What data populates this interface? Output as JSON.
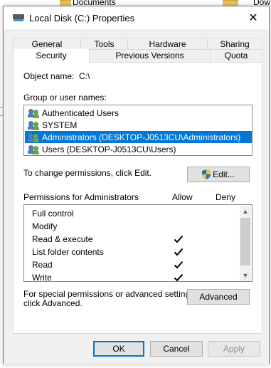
{
  "background": {
    "documents_label": "Documents",
    "right_label": "Dow"
  },
  "window": {
    "title": "Local Disk (C:) Properties",
    "close_glyph": "✕"
  },
  "tabs": {
    "top_row": [
      "General",
      "Tools",
      "Hardware",
      "Sharing"
    ],
    "bottom_row": [
      "Security",
      "Previous Versions",
      "Quota"
    ],
    "active": "Security"
  },
  "security": {
    "object_name_label": "Object name:",
    "object_name_value": "C:\\",
    "group_label": "Group or user names:",
    "users": [
      {
        "name": "Authenticated Users",
        "selected": false
      },
      {
        "name": "SYSTEM",
        "selected": false
      },
      {
        "name": "Administrators (DESKTOP-J0513CU\\Administrators)",
        "selected": true
      },
      {
        "name": "Users (DESKTOP-J0513CU\\Users)",
        "selected": false
      }
    ],
    "change_perm_text": "To change permissions, click Edit.",
    "edit_button": "Edit...",
    "permissions_for_label": "Permissions for Administrators",
    "allow_header": "Allow",
    "deny_header": "Deny",
    "permissions": [
      {
        "name": "Full control",
        "allow": false,
        "deny": false
      },
      {
        "name": "Modify",
        "allow": false,
        "deny": false
      },
      {
        "name": "Read & execute",
        "allow": true,
        "deny": false
      },
      {
        "name": "List folder contents",
        "allow": true,
        "deny": false
      },
      {
        "name": "Read",
        "allow": true,
        "deny": false
      },
      {
        "name": "Write",
        "allow": true,
        "deny": false
      }
    ],
    "advanced_text_line1": "For special permissions or advanced settings,",
    "advanced_text_line2": "click Advanced.",
    "advanced_button": "Advanced"
  },
  "footer": {
    "ok": "OK",
    "cancel": "Cancel",
    "apply": "Apply"
  },
  "colors": {
    "selection": "#0078d7",
    "dialog_bg": "#f0f0f0"
  }
}
